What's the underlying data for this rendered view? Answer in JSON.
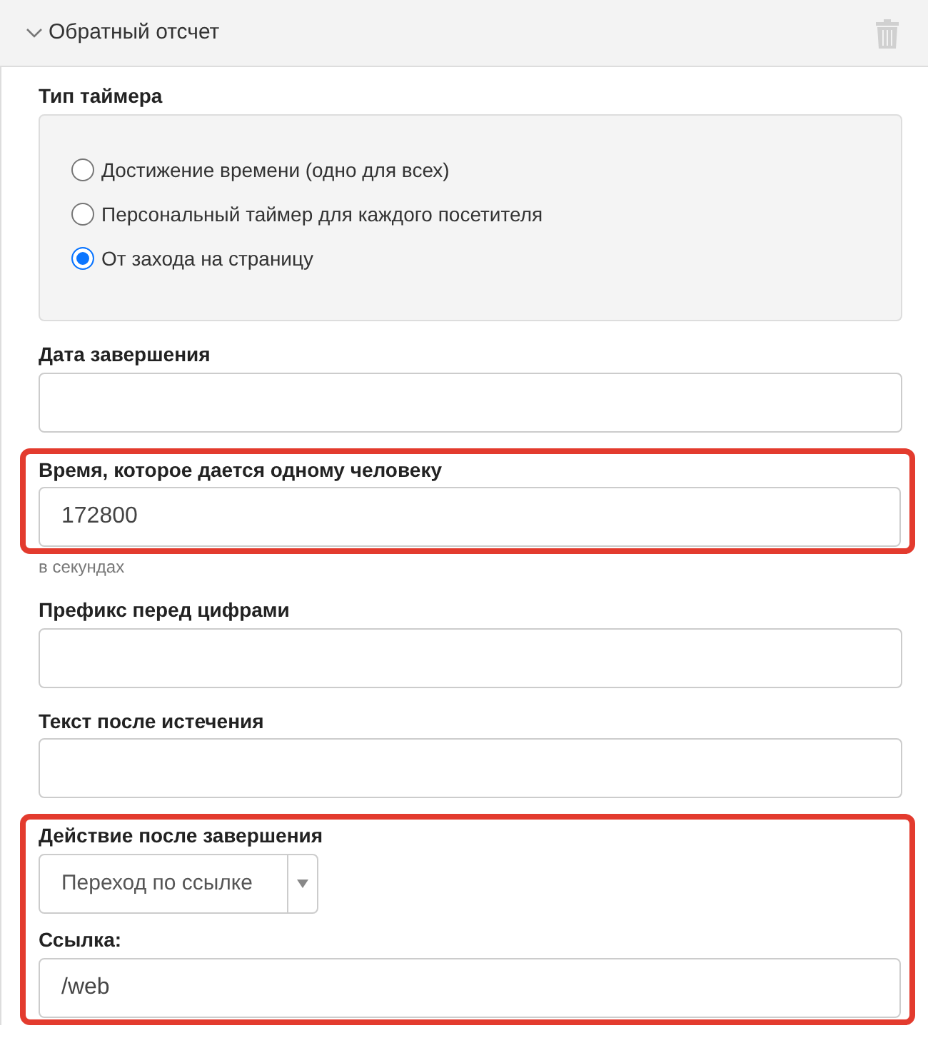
{
  "panel": {
    "title": "Обратный отсчет",
    "expanded": true
  },
  "sections": [
    {
      "highlighted": false,
      "fields": [
        {
          "kind": "radio",
          "label": "Тип таймера",
          "options": [
            {
              "label": "Достижение времени (одно для всех)",
              "selected": false
            },
            {
              "label": "Персональный таймер для каждого посетителя",
              "selected": false
            },
            {
              "label": "От захода на страницу",
              "selected": true
            }
          ]
        },
        {
          "kind": "text",
          "label": "Дата завершения"
        }
      ]
    },
    {
      "highlighted": true,
      "fields": [
        {
          "kind": "text",
          "label": "Время, которое дается одному человеку",
          "value": "172800"
        }
      ]
    },
    {
      "highlighted": false,
      "fields": [
        {
          "kind": "hint",
          "text": "в секундах"
        },
        {
          "kind": "text",
          "label": "Префикс перед цифрами"
        },
        {
          "kind": "text",
          "label": "Текст после истечения"
        }
      ]
    },
    {
      "highlighted": true,
      "fields": [
        {
          "kind": "select",
          "label": "Действие после завершения",
          "value": "Переход по ссылке"
        },
        {
          "kind": "text",
          "label": "Ссылка:",
          "value": "/web"
        }
      ]
    }
  ]
}
